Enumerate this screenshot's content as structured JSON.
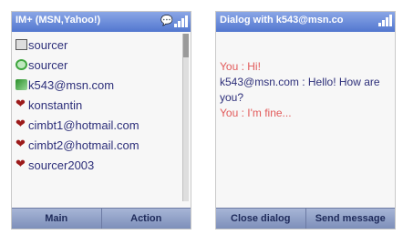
{
  "left_screen": {
    "title": "IM+ (MSN,Yahoo!)",
    "contacts": [
      {
        "name": "sourcer",
        "icon": "email-icon"
      },
      {
        "name": "sourcer",
        "icon": "msn-icon"
      },
      {
        "name": "k543@msn.com",
        "icon": "msn-online-icon"
      },
      {
        "name": "konstantin",
        "icon": "heart-icon"
      },
      {
        "name": "cimbt1@hotmail.com",
        "icon": "heart-icon"
      },
      {
        "name": "cimbt2@hotmail.com",
        "icon": "heart-icon"
      },
      {
        "name": "sourcer2003",
        "icon": "heart-icon"
      }
    ],
    "softkeys": {
      "left": "Main",
      "right": "Action"
    }
  },
  "right_screen": {
    "title": "Dialog with k543@msn.co",
    "messages": [
      {
        "text": "You : Hi!",
        "color": "#e25a5a"
      },
      {
        "text": "k543@msn.com : Hello! How are you?",
        "color": "#2d2f7a"
      },
      {
        "text": "You : I'm fine...",
        "color": "#e25a5a"
      }
    ],
    "softkeys": {
      "left": "Close dialog",
      "right": "Send message"
    }
  },
  "colors": {
    "titlebar": "#5277cf",
    "softkey_bar": "#7d8fba",
    "contact_text": "#2d2f7a",
    "sent_text": "#e25a5a"
  }
}
